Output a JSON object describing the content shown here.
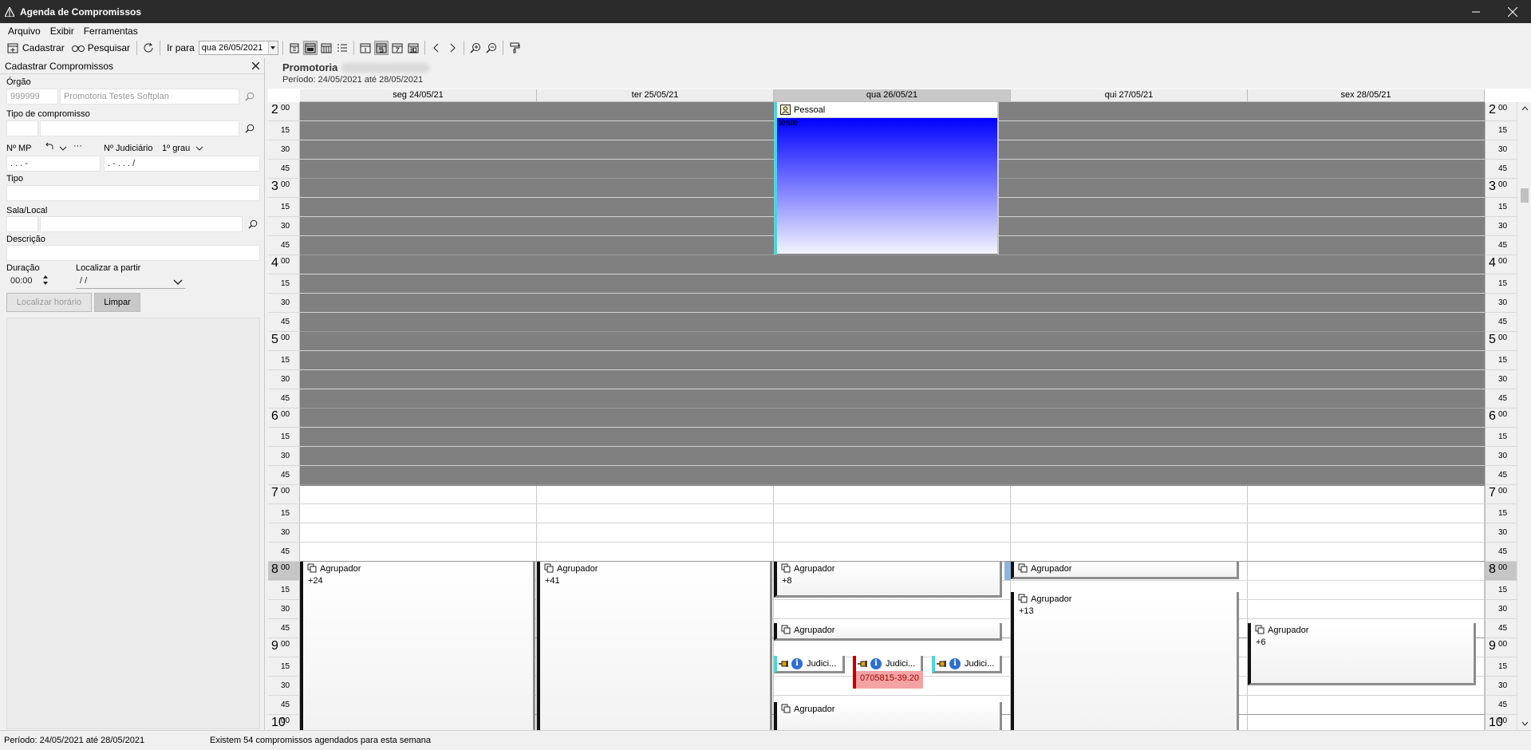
{
  "window": {
    "title": "Agenda de Compromissos"
  },
  "menu": {
    "items": [
      "Arquivo",
      "Exibir",
      "Ferramentas"
    ]
  },
  "toolbar": {
    "cadastrar": "Cadastrar",
    "pesquisar": "Pesquisar",
    "goto_label": "Ir para",
    "goto_value": "qua 26/05/2021"
  },
  "left_panel": {
    "title": "Cadastrar Compromissos",
    "orgao_label": "Órgão",
    "orgao_code": "999999",
    "orgao_name": "Promotoria Testes Softplan",
    "tipo_compromisso_label": "Tipo de compromisso",
    "nmp_label": "Nº MP",
    "nmp_ellipsis": "···",
    "njud_label": "Nº Judiciário",
    "grau_label": "1º grau",
    "nmp_value": ". . . -",
    "njud_value": ". - . . . /",
    "tipo_label": "Tipo",
    "sala_label": "Sala/Local",
    "descricao_label": "Descrição",
    "duracao_label": "Duração",
    "duracao_value": "00:00",
    "localizar_partir_label": "Localizar a partir",
    "localizar_partir_value": "/ /",
    "localizar_button": "Localizar horário",
    "limpar_button": "Limpar"
  },
  "calendar": {
    "org": "Promotoria",
    "period": "Período: 24/05/2021 até 28/05/2021",
    "days": [
      "seg 24/05/21",
      "ter 25/05/21",
      "qua 26/05/21",
      "qui 27/05/21",
      "sex 28/05/21"
    ],
    "today_index": 2,
    "hours": [
      "2",
      "3",
      "4",
      "5",
      "6",
      "7",
      "8",
      "9",
      "10"
    ],
    "hour_min": "00",
    "quarters": [
      "15",
      "30",
      "45"
    ],
    "highlight_hour": "8",
    "events": {
      "pessoal_title": "Pessoal",
      "pessoal_text": "teste",
      "agrupador": "Agrupador",
      "mon_count": "+24",
      "tue_count": "+41",
      "wed_count": "+8",
      "thu_count": "+13",
      "fri_count": "+6",
      "judicial": "Judici...",
      "judicial_number": "0705815-39.20"
    }
  },
  "status": {
    "period": "Período: 24/05/2021 até 28/05/2021",
    "message": "Existem 54 compromissos agendados para esta semana"
  }
}
